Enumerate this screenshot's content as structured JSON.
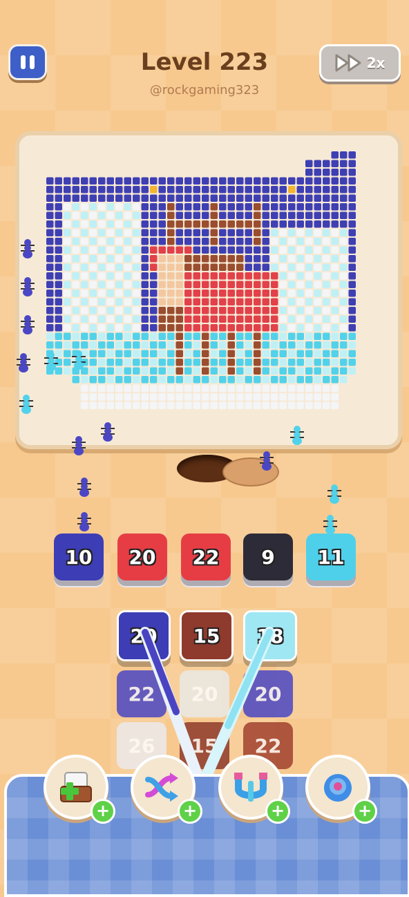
{
  "header": {
    "title": "Level 223",
    "subtitle": "@rockgaming323",
    "speed_label": "2x"
  },
  "icons": [
    "pause-icon",
    "fast-forward-icon",
    "add-box-icon",
    "shuffle-icon",
    "magnet-icon",
    "donut-icon",
    "plus-icon"
  ],
  "queue": [
    {
      "value": "10",
      "color": "#3d3db5"
    },
    {
      "value": "20",
      "color": "#e63d45"
    },
    {
      "value": "22",
      "color": "#e63d45"
    },
    {
      "value": "9",
      "color": "#2e2b38"
    },
    {
      "value": "11",
      "color": "#4fd0ea"
    }
  ],
  "stacks": [
    [
      {
        "value": "20",
        "color": "#3d3db5"
      },
      {
        "value": "22",
        "color": "#4b47c4"
      },
      {
        "value": "26",
        "color": "#eceaea"
      }
    ],
    [
      {
        "value": "15",
        "color": "#8e3a2c"
      },
      {
        "value": "20",
        "color": "#ebe9e6"
      },
      {
        "value": "15",
        "color": "#8e3a2c"
      }
    ],
    [
      {
        "value": "18",
        "color": "#9fe7f2"
      },
      {
        "value": "20",
        "color": "#4b47c4"
      },
      {
        "value": "22",
        "color": "#a2412f"
      }
    ]
  ],
  "powerups": [
    "add-box",
    "shuffle",
    "magnet",
    "donut"
  ],
  "palette": {
    "navy": "#3f3fb4",
    "brown": "#9a4d2f",
    "red": "#e2414a",
    "beige": "#f3c8a0",
    "ice": "#52d2ea",
    "paleice": "#bff0f6",
    "white": "#f4f5f7",
    "gold": "#f3b532"
  }
}
